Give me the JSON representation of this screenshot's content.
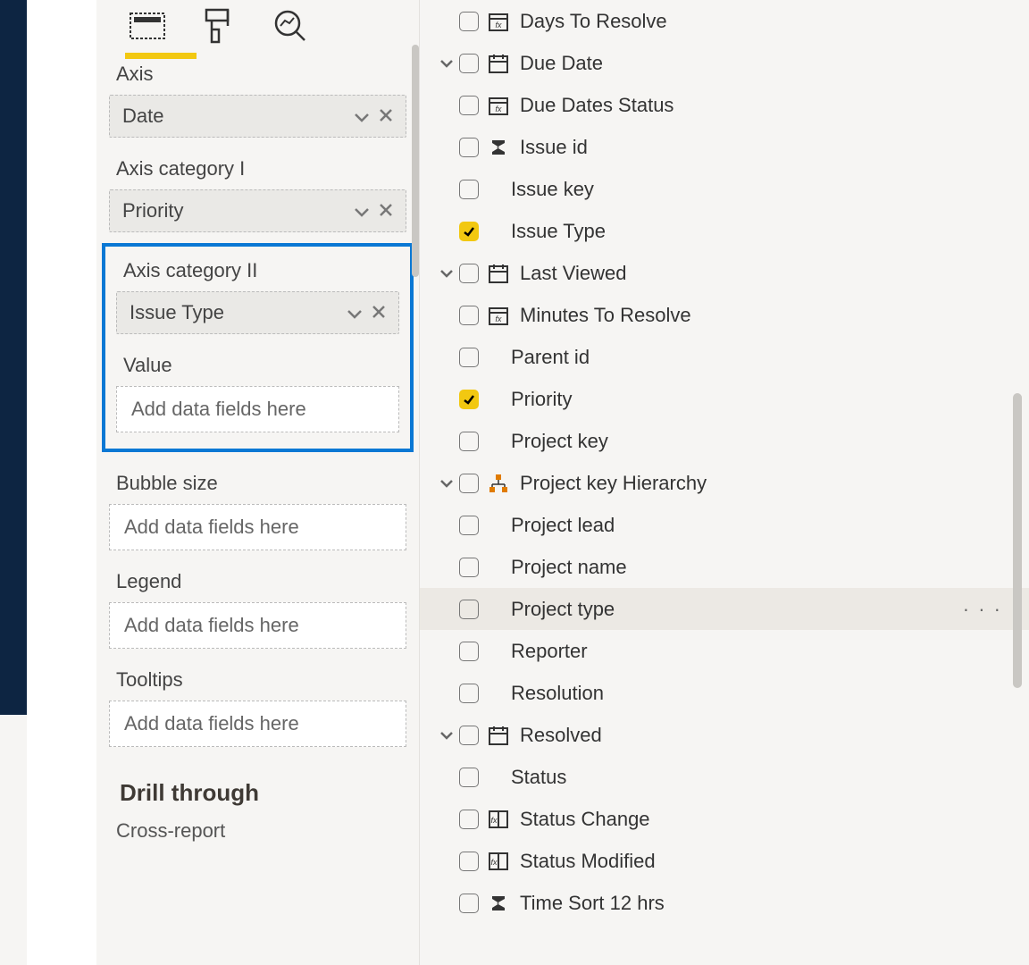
{
  "viz": {
    "wells": [
      {
        "label": "Axis",
        "field": "Date"
      },
      {
        "label": "Axis category I",
        "field": "Priority"
      }
    ],
    "highlighted": {
      "cat2_label": "Axis category II",
      "cat2_field": "Issue Type",
      "value_label": "Value",
      "value_placeholder": "Add data fields here"
    },
    "remaining": [
      {
        "label": "Bubble size",
        "placeholder": "Add data fields here"
      },
      {
        "label": "Legend",
        "placeholder": "Add data fields here"
      },
      {
        "label": "Tooltips",
        "placeholder": "Add data fields here"
      }
    ],
    "drill_heading": "Drill through",
    "cross_report": "Cross-report"
  },
  "fields": {
    "items": [
      {
        "label": "Days To Resolve",
        "checked": false,
        "icon": "dayscalc",
        "expand": false
      },
      {
        "label": "Due Date",
        "checked": false,
        "icon": "calendar",
        "expand": true
      },
      {
        "label": "Due Dates Status",
        "checked": false,
        "icon": "dayscalc",
        "expand": false
      },
      {
        "label": "Issue id",
        "checked": false,
        "icon": "sigma",
        "expand": false
      },
      {
        "label": "Issue key",
        "checked": false,
        "icon": "",
        "expand": false
      },
      {
        "label": "Issue Type",
        "checked": true,
        "icon": "",
        "expand": false
      },
      {
        "label": "Last Viewed",
        "checked": false,
        "icon": "calendar",
        "expand": true
      },
      {
        "label": "Minutes To Resolve",
        "checked": false,
        "icon": "dayscalc",
        "expand": false
      },
      {
        "label": "Parent id",
        "checked": false,
        "icon": "",
        "expand": false
      },
      {
        "label": "Priority",
        "checked": true,
        "icon": "",
        "expand": false
      },
      {
        "label": "Project key",
        "checked": false,
        "icon": "",
        "expand": false
      },
      {
        "label": "Project key Hierarchy",
        "checked": false,
        "icon": "hierarchy",
        "expand": true
      },
      {
        "label": "Project lead",
        "checked": false,
        "icon": "",
        "expand": false
      },
      {
        "label": "Project name",
        "checked": false,
        "icon": "",
        "expand": false
      },
      {
        "label": "Project type",
        "checked": false,
        "icon": "",
        "expand": false,
        "hovered": true
      },
      {
        "label": "Reporter",
        "checked": false,
        "icon": "",
        "expand": false
      },
      {
        "label": "Resolution",
        "checked": false,
        "icon": "",
        "expand": false
      },
      {
        "label": "Resolved",
        "checked": false,
        "icon": "calendar",
        "expand": true
      },
      {
        "label": "Status",
        "checked": false,
        "icon": "",
        "expand": false
      },
      {
        "label": "Status Change",
        "checked": false,
        "icon": "calccol",
        "expand": false
      },
      {
        "label": "Status Modified",
        "checked": false,
        "icon": "calccol",
        "expand": false
      },
      {
        "label": "Time Sort 12 hrs",
        "checked": false,
        "icon": "sigma",
        "expand": false
      }
    ]
  }
}
